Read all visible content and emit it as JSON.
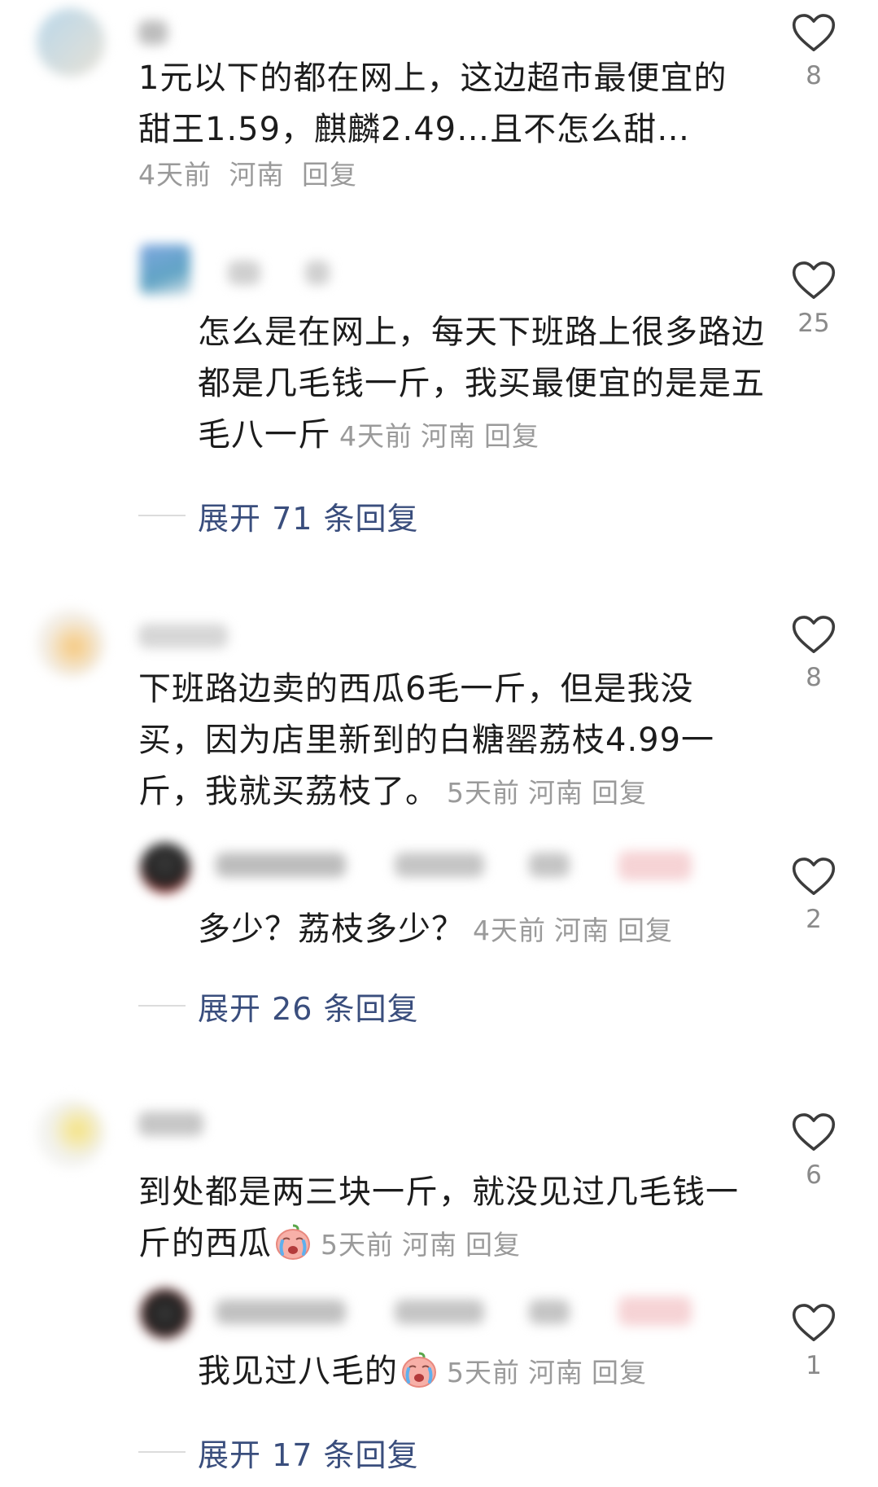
{
  "comments": [
    {
      "text": "1元以下的都在网上，这边超市最便宜的甜王1.59，麒麟2.49…且不怎么甜…",
      "time": "4天前",
      "location": "河南",
      "reply_label": "回复",
      "likes": "8",
      "reply": {
        "text": "怎么是在网上，每天下班路上很多路边都是几毛钱一斤，我买最便宜的是是五毛八一斤",
        "time": "4天前",
        "location": "河南",
        "reply_label": "回复",
        "likes": "25"
      },
      "expand_label": "展开 71 条回复"
    },
    {
      "text": "下班路边卖的西瓜6毛一斤，但是我没买，因为店里新到的白糖罂荔枝4.99一斤，我就买荔枝了。",
      "time": "5天前",
      "location": "河南",
      "reply_label": "回复",
      "likes": "8",
      "reply": {
        "text": "多少？荔枝多少？",
        "time": "4天前",
        "location": "河南",
        "reply_label": "回复",
        "likes": "2"
      },
      "expand_label": "展开 26 条回复"
    },
    {
      "text": "到处都是两三块一斤，就没见过几毛钱一斤的西瓜",
      "time": "5天前",
      "location": "河南",
      "reply_label": "回复",
      "likes": "6",
      "reply": {
        "text": "我见过八毛的",
        "time": "5天前",
        "location": "河南",
        "reply_label": "回复",
        "likes": "1"
      },
      "expand_label": "展开 17 条回复"
    }
  ],
  "colors": {
    "meta": "#9a9a9a",
    "expand_link": "#3a4e7d",
    "text": "#1c1c1c"
  },
  "icons": {
    "like": "heart-outline-icon",
    "emoji": "crying-emoji-icon"
  }
}
